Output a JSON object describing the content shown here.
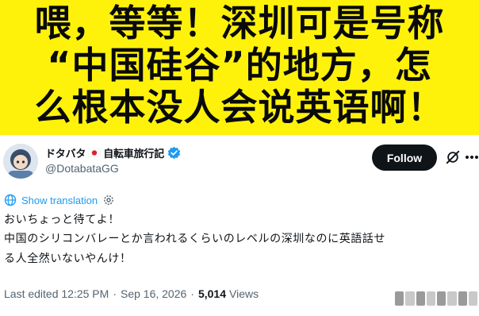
{
  "banner": {
    "line1": "喂，等等！深圳可是号称",
    "line2": "“中国硅谷”的地方，怎",
    "line3": "么根本没人会说英语啊！"
  },
  "tweet": {
    "display_name": "ドタバタ",
    "display_name_suffix": "自転車旅行記",
    "flag_icon": "japan-flag-icon",
    "verified_icon": "verified-badge-icon",
    "handle": "@DotabataGG",
    "follow_label": "Follow",
    "translation_label": "Show translation",
    "text_line1": "おいちょっと待てよ！",
    "text_line2": "中国のシリコンバレーとか言われるくらいのレベルの深圳なのに英語話せ",
    "text_line3": "る人全然いないやんけ！",
    "edited_time": "Last edited 12:25 PM",
    "separator": "·",
    "date": "Sep 16, 2026",
    "views_count": "5,014",
    "views_label": "Views"
  },
  "colors": {
    "banner_bg": "#fff20a",
    "link_blue": "#1d9bf0",
    "button_bg": "#0f1419",
    "muted_text": "#536471",
    "verified_blue": "#1d9bf0"
  }
}
